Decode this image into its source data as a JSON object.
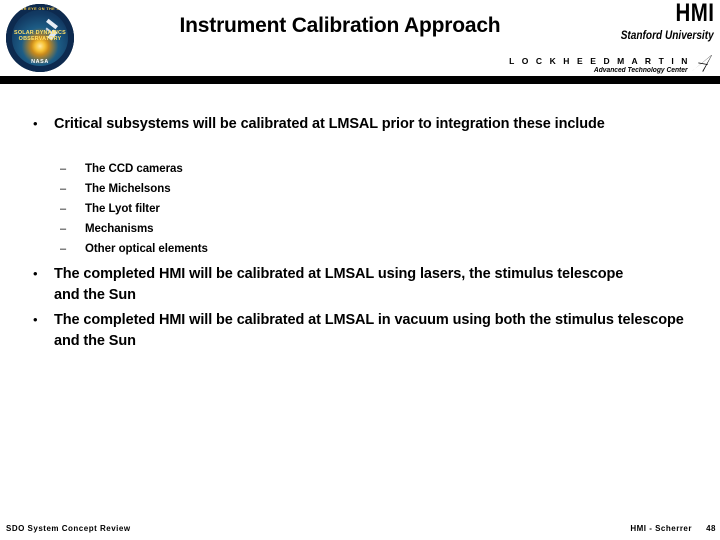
{
  "slide": {
    "title": "Instrument Calibration Approach",
    "page_number": "48"
  },
  "header": {
    "logo": {
      "name": "sdo-mission-patch",
      "ring_text": "YOUR EYE ON THE SUN",
      "core_text": "SOLAR DYNAMICS OBSERVATORY",
      "agency": "NASA"
    },
    "hmi_wordmark": "HMI",
    "stanford": "Stanford University",
    "lockheed_martin": "L O C K H E E D   M A R T I N",
    "lockheed_tagline": "Advanced Technology Center"
  },
  "body": {
    "bullets": [
      {
        "level": 1,
        "marker": "•",
        "text": "Critical subsystems will be calibrated at LMSAL prior to integration these include"
      },
      {
        "level": 2,
        "marker": "–",
        "text": "The CCD cameras"
      },
      {
        "level": 2,
        "marker": "–",
        "text": "The Michelsons"
      },
      {
        "level": 2,
        "marker": "–",
        "text": "The Lyot filter"
      },
      {
        "level": 2,
        "marker": "–",
        "text": "Mechanisms"
      },
      {
        "level": 2,
        "marker": "–",
        "text": "Other optical elements"
      },
      {
        "level": 1,
        "marker": "•",
        "text": "The completed HMI will be calibrated at LMSAL using lasers, the stimulus telescope and the Sun"
      },
      {
        "level": 1,
        "marker": "•",
        "text": "The completed HMI will be calibrated at LMSAL in vacuum using both the stimulus telescope and the Sun"
      }
    ]
  },
  "footer": {
    "left": "SDO System Concept Review",
    "right": "HMI - Scherrer",
    "page": "48"
  },
  "colors": {
    "background": "#ffffff",
    "text": "#000000",
    "rule": "#000000",
    "logo_navy": "#0d2a4f",
    "logo_sun": "#f6c033"
  }
}
